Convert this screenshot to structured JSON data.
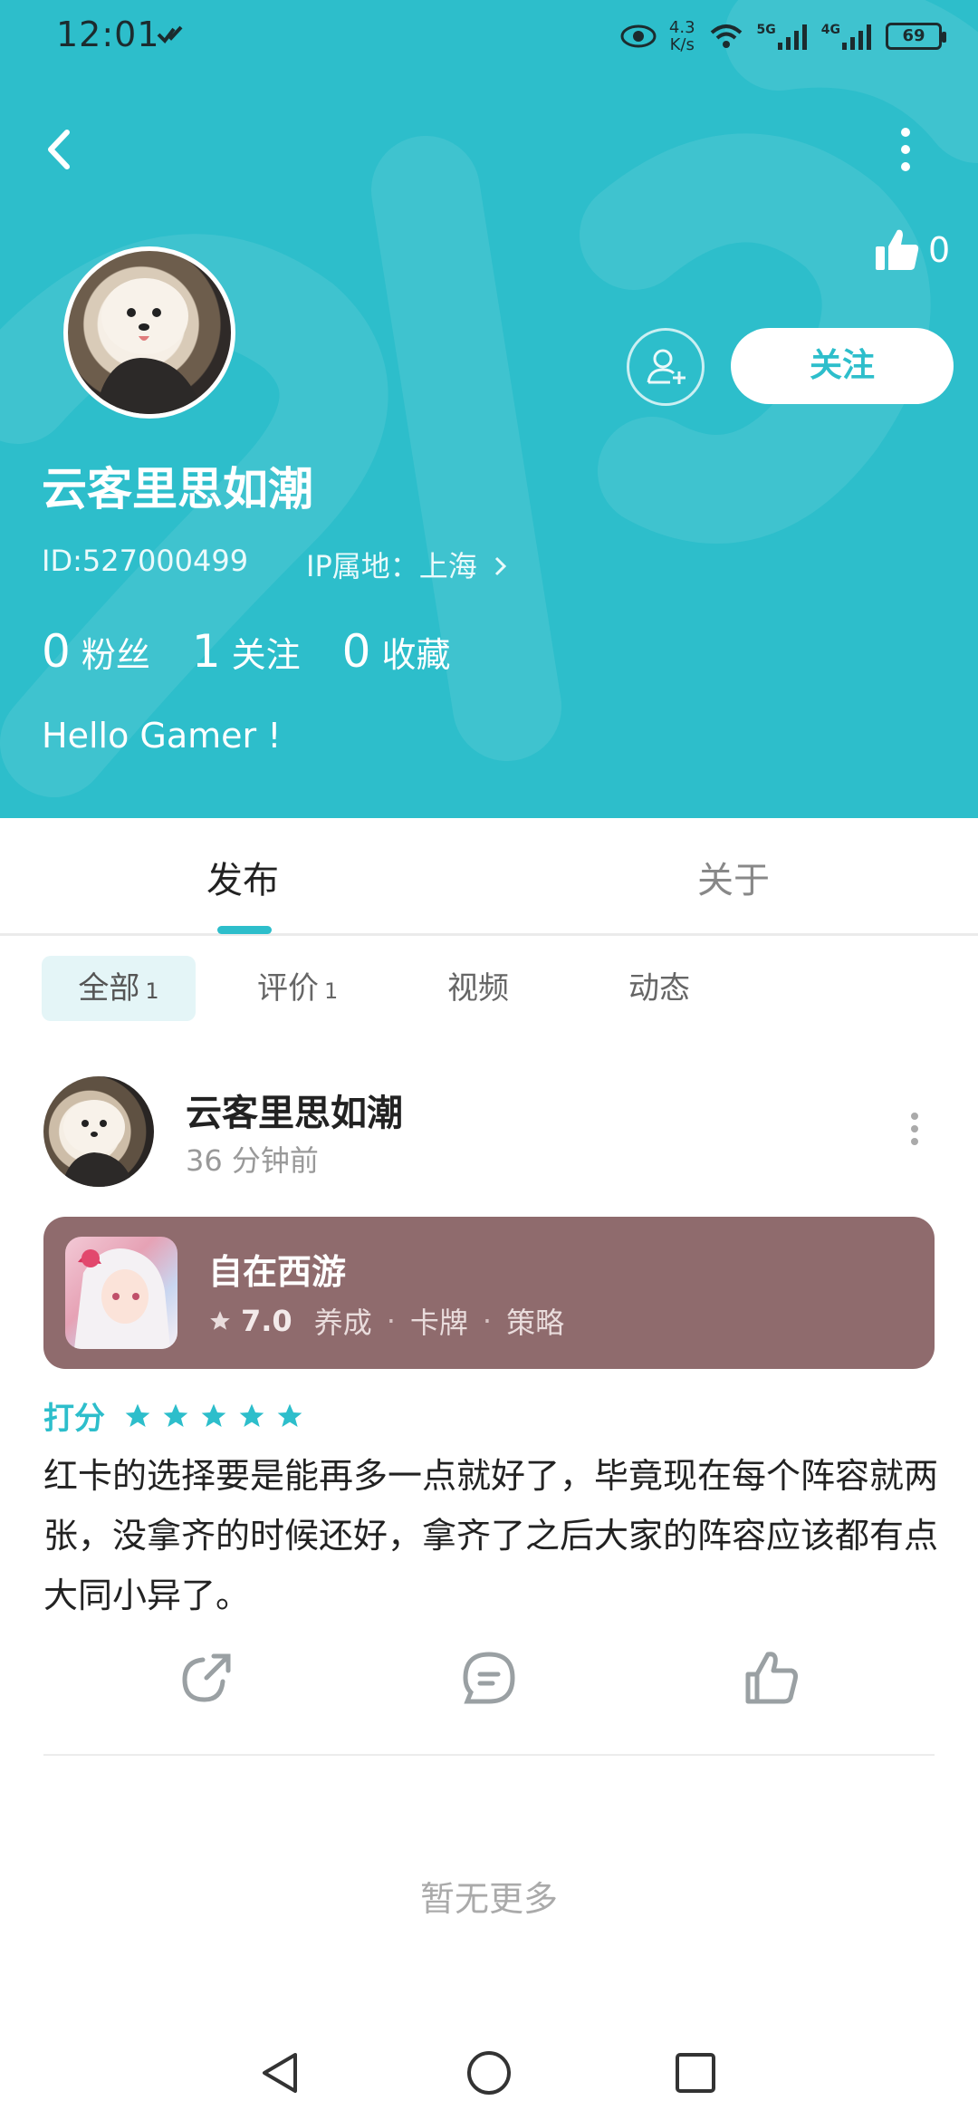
{
  "status_bar": {
    "time": "12:01",
    "net_speed_value": "4.3",
    "net_speed_unit": "K/s",
    "signal_1": "5G",
    "signal_2": "4G",
    "battery": "69"
  },
  "header": {
    "likes_count": "0",
    "follow_label": "关注",
    "user_name": "云客里思如潮",
    "user_id": "ID:527000499",
    "ip_location": "IP属地：上海",
    "stats": [
      {
        "num": "0",
        "label": "粉丝"
      },
      {
        "num": "1",
        "label": "关注"
      },
      {
        "num": "0",
        "label": "收藏"
      }
    ],
    "bio": "Hello Gamer !"
  },
  "tabs": {
    "publish": "发布",
    "about": "关于"
  },
  "filters": {
    "all": "全部",
    "all_count": "1",
    "review": "评价",
    "review_count": "1",
    "video": "视频",
    "dynamic": "动态"
  },
  "post": {
    "author": "云客里思如潮",
    "time": "36 分钟前",
    "game": {
      "name": "自在西游",
      "score": "7.0",
      "tags": [
        "养成",
        "卡牌",
        "策略"
      ]
    },
    "rating_label": "打分",
    "rating_stars": 5,
    "text": "红卡的选择要是能再多一点就好了，毕竟现在每个阵容就两张，没拿齐的时候还好，拿齐了之后大家的阵容应该都有点大同小异了。"
  },
  "footer": {
    "no_more": "暂无更多"
  },
  "colors": {
    "accent": "#2dbecb",
    "game_card": "#8f6b6d"
  }
}
